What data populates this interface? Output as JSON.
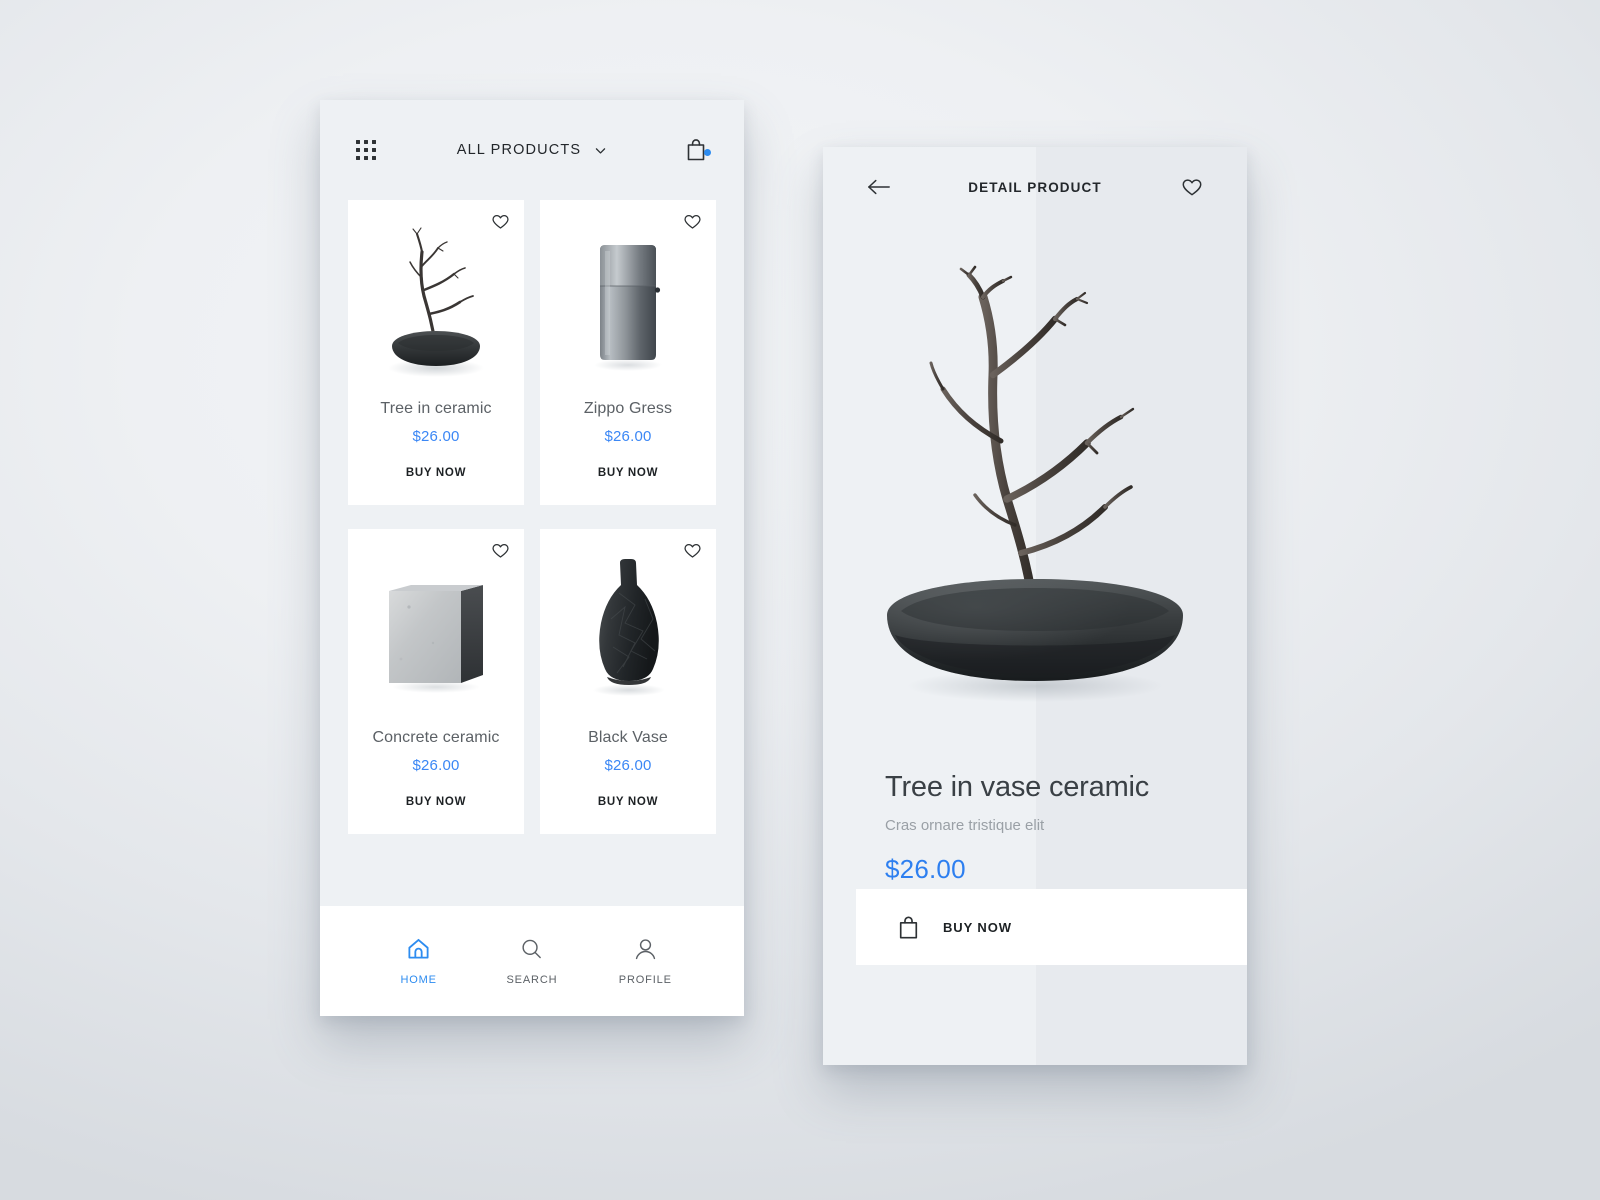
{
  "theme": {
    "accent_blue": "#2d8cf0",
    "price_blue": "#3b87f5",
    "card_bg": "#ffffff",
    "screen_bg": "#eef1f4",
    "page_bg": "#e4e7eb",
    "text_dark": "#23272b",
    "text_muted": "#9aa0a6"
  },
  "listing_screen": {
    "header": {
      "grid_icon": "grid-menu-icon",
      "title": "ALL PRODUCTS",
      "chevron_icon": "chevron-down-icon",
      "bag_icon": "shopping-bag-icon",
      "bag_badge": true
    },
    "buy_label": "BUY NOW",
    "favorite_icon": "heart-outline-icon",
    "products": [
      {
        "name": "Tree in ceramic",
        "price": "$26.00",
        "image": "tree-in-ceramic-bowl"
      },
      {
        "name": "Zippo Gress",
        "price": "$26.00",
        "image": "zippo-lighter"
      },
      {
        "name": "Concrete ceramic",
        "price": "$26.00",
        "image": "concrete-cube"
      },
      {
        "name": "Black Vase",
        "price": "$26.00",
        "image": "black-vase"
      }
    ],
    "bottom_nav": [
      {
        "label": "HOME",
        "icon": "home-icon",
        "active": true
      },
      {
        "label": "SEARCH",
        "icon": "search-icon",
        "active": false
      },
      {
        "label": "PROFILE",
        "icon": "profile-icon",
        "active": false
      }
    ]
  },
  "detail_screen": {
    "header": {
      "back_icon": "arrow-left-icon",
      "title": "DETAIL PRODUCT",
      "favorite_icon": "heart-outline-icon"
    },
    "hero_image": "tree-in-vase-ceramic",
    "product": {
      "name": "Tree in vase ceramic",
      "subtitle": "Cras ornare tristique elit",
      "price": "$26.00"
    },
    "buy_button": {
      "icon": "shopping-bag-icon",
      "label": "BUY NOW"
    }
  }
}
